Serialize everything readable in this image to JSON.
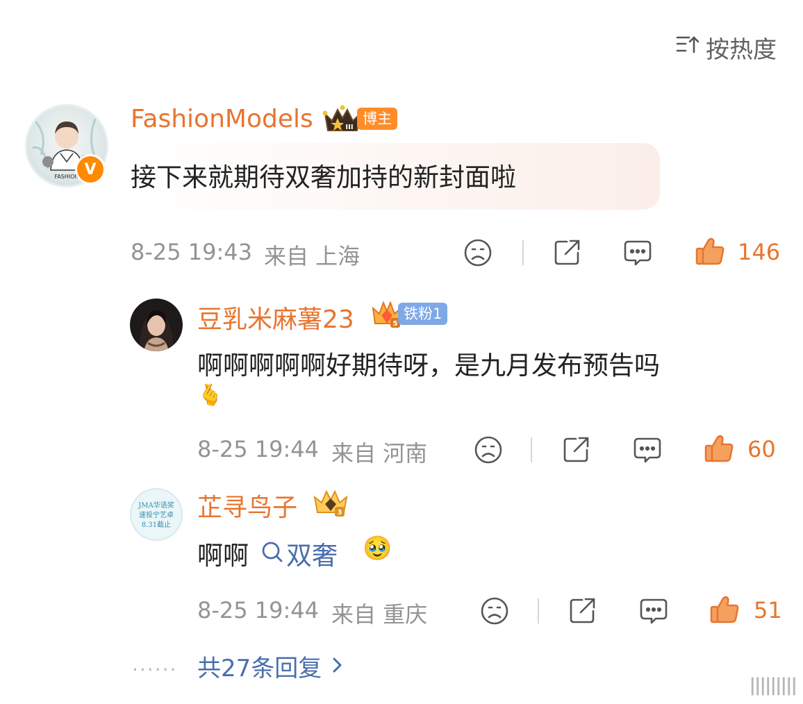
{
  "sort": {
    "label": "按热度",
    "icon": "sort-icon"
  },
  "main_comment": {
    "username": "FashionModels",
    "badge": "博主",
    "avatar_text": "FASHION",
    "verified_mark": "V",
    "crown_level": "III",
    "text": "接下来就期待双奢加持的新封面啦",
    "time": "8-25 19:43",
    "from": "来自 上海",
    "likes": "146"
  },
  "replies": [
    {
      "username": "豆乳米麻薯23",
      "badge": "铁粉1",
      "crown_level": "5",
      "text_line1": "啊啊啊啊啊好期待呀，是九月发布预告吗",
      "emoji": "🫰",
      "time": "8-25 19:44",
      "from": "来自 河南",
      "likes": "60"
    },
    {
      "username": "芷寻鸟子",
      "crown_level": "3",
      "avatar_lines": [
        "JMA华语奖",
        "速投宁艺卓",
        "8.31截止"
      ],
      "text_prefix": "啊啊",
      "topic": "双奢",
      "emoji": "🥹",
      "time": "8-25 19:44",
      "from": "来自 重庆",
      "likes": "51"
    }
  ],
  "more_replies": {
    "dots": "......",
    "label": "共27条回复"
  },
  "watermark": "|||||||||",
  "colors": {
    "accent": "#e8742e",
    "link": "#4a6dad",
    "meta": "#939393",
    "blogger_badge": "#ff8c2a",
    "fan_badge": "#7fa8e6"
  }
}
